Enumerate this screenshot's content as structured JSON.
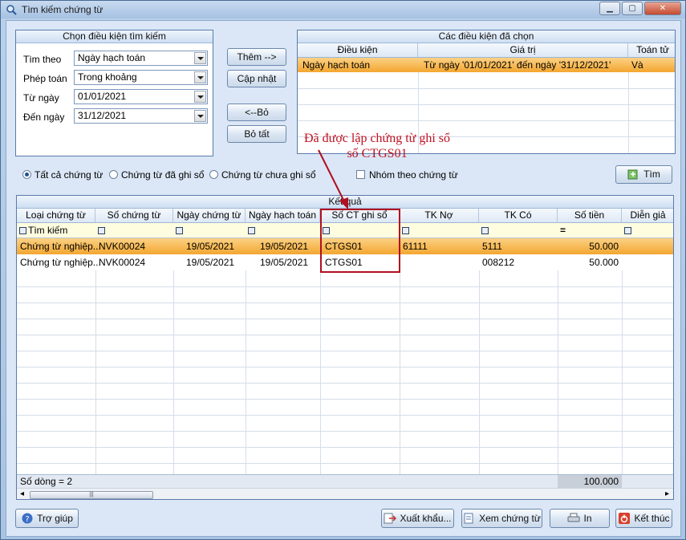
{
  "window": {
    "title": "Tìm kiếm chứng từ"
  },
  "criteria": {
    "header": "Chọn điều kiện tìm kiếm",
    "search_by_label": "Tìm theo",
    "search_by_value": "Ngày hạch toán",
    "operator_label": "Phép toán",
    "operator_value": "Trong khoảng",
    "from_label": "Từ ngày",
    "from_value": "01/01/2021",
    "to_label": "Đến ngày",
    "to_value": "31/12/2021"
  },
  "mid_buttons": {
    "add": "Thêm -->",
    "update": "Cập nhật",
    "remove": "<--Bỏ",
    "remove_all": "Bỏ tất"
  },
  "selected": {
    "header": "Các điều kiện đã chọn",
    "columns": [
      "Điều kiện",
      "Giá trị",
      "Toán tử"
    ],
    "row": {
      "condition": "Ngày hạch toán",
      "value": "Từ ngày '01/01/2021' đến ngày '31/12/2021'",
      "operator": "Và"
    }
  },
  "annotation": {
    "line1": "Đã được lập chứng từ ghi sổ",
    "line2": "số CTGS01"
  },
  "filters": {
    "all": "Tất cả chứng từ",
    "posted": "Chứng từ đã ghi sổ",
    "not_posted": "Chứng từ chưa ghi sổ",
    "group": "Nhóm theo chứng từ",
    "search_button": "Tìm"
  },
  "results": {
    "header": "Kết quả",
    "columns": [
      "Loại chứng từ",
      "Số chứng từ",
      "Ngày chứng từ",
      "Ngày hạch toán",
      "Số CT ghi sổ",
      "TK Nợ",
      "TK Có",
      "Số tiền",
      "Diễn giả"
    ],
    "filter_row_label": "Tìm kiếm",
    "filter_eq": "=",
    "rows": [
      [
        "Chứng từ nghiệp...",
        "NVK00024",
        "19/05/2021",
        "19/05/2021",
        "CTGS01",
        "61111",
        "5111",
        "50.000"
      ],
      [
        "Chứng từ nghiệp...",
        "NVK00024",
        "19/05/2021",
        "19/05/2021",
        "CTGS01",
        "",
        "008212",
        "50.000"
      ]
    ],
    "row_count": "Số dòng = 2",
    "total": "100.000"
  },
  "footer": {
    "help": "Trợ giúp",
    "export": "Xuất khẩu...",
    "view": "Xem chứng từ",
    "print": "In",
    "close": "Kết thúc"
  },
  "colors": {
    "selected_row": "#f7b23b",
    "annotation": "#c01020",
    "highlight_box": "#b01020"
  }
}
